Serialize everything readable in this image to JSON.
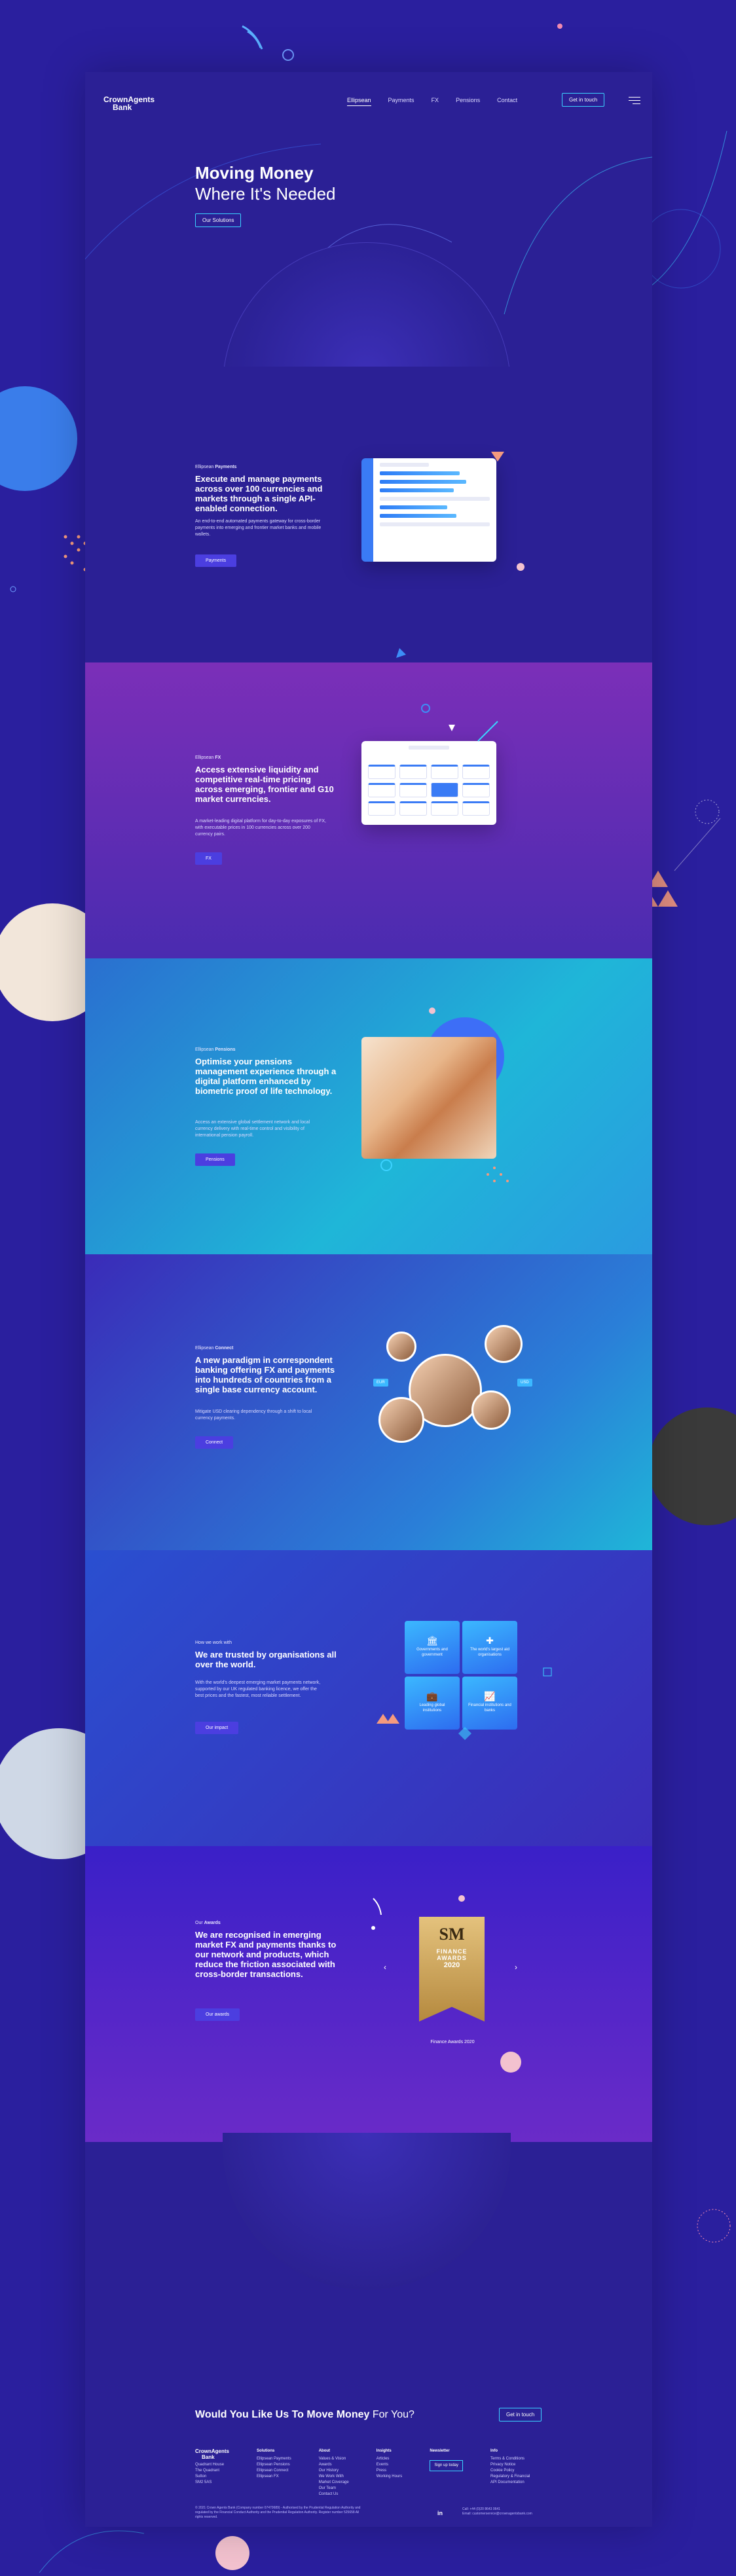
{
  "brand": {
    "name_line1": "CrownAgents",
    "name_line2": "Bank"
  },
  "nav": {
    "items": [
      "Ellipsean",
      "Payments",
      "FX",
      "Pensions",
      "Contact"
    ],
    "active": "Ellipsean",
    "cta": "Get in touch"
  },
  "hero": {
    "title_line1": "Moving Money",
    "title_line2": "Where It's Needed",
    "cta": "Our Solutions"
  },
  "sections": {
    "payments": {
      "eyebrow_prefix": "Ellipsean",
      "eyebrow_name": "Payments",
      "title": "Execute and manage payments across over 100 currencies and markets through a single API-enabled connection.",
      "body": "An end-to-end automated payments gateway for cross-border payments into emerging and frontier market banks and mobile wallets.",
      "button": "Payments"
    },
    "fx": {
      "eyebrow_prefix": "Ellipsean",
      "eyebrow_name": "FX",
      "title": "Access extensive liquidity and competitive real-time pricing across emerging, frontier and G10 market currencies.",
      "body": "A market-leading digital platform for day-to-day exposures of FX, with executable prices in 100 currencies across over 200 currency pairs.",
      "button": "FX"
    },
    "pensions": {
      "eyebrow_prefix": "Ellipsean",
      "eyebrow_name": "Pensions",
      "title": "Optimise your pensions management experience through a digital platform enhanced by biometric proof of life technology.",
      "body": "Access an extensive global settlement network and local currency delivery with real-time control and visibility of international pension payroll.",
      "button": "Pensions"
    },
    "connect": {
      "eyebrow_prefix": "Ellipsean",
      "eyebrow_name": "Connect",
      "title": "A new paradigm in correspondent banking offering FX and payments into hundreds of countries from a single base currency account.",
      "body": "Mitigate USD clearing dependency through a shift to local currency payments.",
      "button": "Connect",
      "badge_left": "EUR",
      "badge_right": "USD"
    },
    "trust": {
      "eyebrow": "How we work with",
      "title": "We are trusted by organisations all over the world.",
      "body": "With the world's deepest emerging market payments network, supported by our UK regulated banking licence, we offer the best prices and the fastest, most reliable settlement.",
      "button": "Our impact",
      "tiles": [
        {
          "icon": "bank-icon",
          "glyph": "🏛",
          "label": "Governments and government"
        },
        {
          "icon": "plus-icon",
          "glyph": "✚",
          "label": "The world's largest aid organisations"
        },
        {
          "icon": "briefcase-icon",
          "glyph": "💼",
          "label": "Leading global institutions"
        },
        {
          "icon": "chart-icon",
          "glyph": "📈",
          "label": "Financial institutions and banks"
        }
      ]
    },
    "awards": {
      "eyebrow_prefix": "Our",
      "eyebrow_name": "Awards",
      "title": "We are recognised in emerging market FX and payments thanks to our network and products, which reduce the friction associated with cross-border transactions.",
      "button": "Our awards",
      "award": {
        "monogram": "SM",
        "line1": "FINANCE",
        "line2": "AWARDS",
        "year": "2020"
      },
      "caption": "Finance Awards 2020"
    }
  },
  "footer": {
    "question_bold": "Would You Like Us To Move Money",
    "question_light": "For You?",
    "cta": "Get in touch",
    "brand_line1": "CrownAgents",
    "brand_line2": "Bank",
    "brand_links": [
      "Quadrant House",
      "The Quadrant",
      "Sutton",
      "SM2 5AS"
    ],
    "columns": [
      {
        "title": "Solutions",
        "links": [
          "Ellipsean Payments",
          "Ellipsean Pensions",
          "Ellipsean Connect",
          "Ellipsean FX"
        ]
      },
      {
        "title": "About",
        "links": [
          "Values & Vision",
          "Awards",
          "Our History",
          "We Work With",
          "Market Coverage",
          "Our Team",
          "Contact Us"
        ]
      },
      {
        "title": "Insights",
        "links": [
          "Articles",
          "Events",
          "Press",
          "Working Hours"
        ]
      },
      {
        "title": "Newsletter",
        "links": [],
        "button": "Sign up today"
      },
      {
        "title": "Info",
        "links": [
          "Terms & Conditions",
          "Privacy Notice",
          "Cookie Policy",
          "Regulatory & Financial",
          "API Documentation"
        ]
      }
    ],
    "legal": "© 2021 Crown Agents Bank (Company number 07470689) - Authorised by the Prudential Regulation Authority and regulated by the Financial Conduct Authority and the Prudential Regulation Authority. Register number 525658 All rights reserved.",
    "social": "in",
    "contact_phone": "Call: +44 (0)20 8643 0641",
    "contact_email": "Email: customerservice@crownagentsbank.com"
  },
  "colors": {
    "background": "#2a1f9e",
    "accent_cyan": "#3bd3ff",
    "button_fill": "#4b3ee0",
    "fx_gradient_top": "#7b2fb8",
    "pensions_gradient": "#1fb6d8",
    "award_gold": "#d9b46a"
  }
}
